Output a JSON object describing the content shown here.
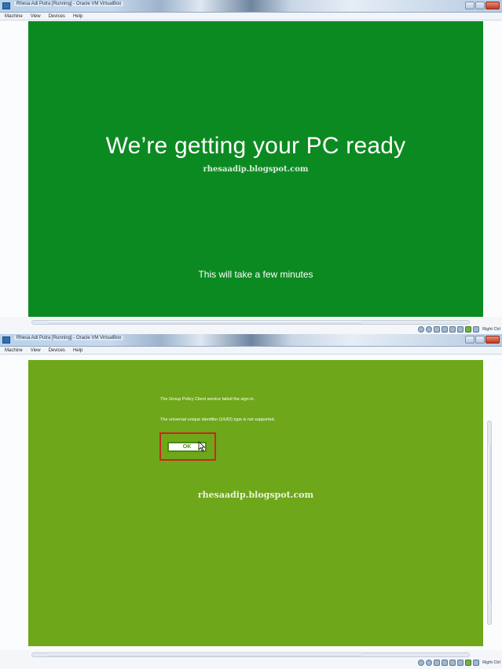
{
  "windows": [
    {
      "title": "Rhesa Adi Putra [Running] - Oracle VM VirtualBox",
      "menu": [
        "Machine",
        "View",
        "Devices",
        "Help"
      ],
      "guest": {
        "heading": "We’re getting your PC ready",
        "watermark": "rhesaadip.blogspot.com",
        "subtitle": "This will take a few minutes",
        "background": "#0c8a22"
      },
      "status": {
        "host_key": "Right Ctrl"
      }
    },
    {
      "title": "Rhesa Adi Putra [Running] - Oracle VM VirtualBox",
      "menu": [
        "Machine",
        "View",
        "Devices",
        "Help"
      ],
      "guest": {
        "error_line_1": "The Group Policy Client service failed the sign-in.",
        "error_line_2": "The universal unique identifier (UUID) type is not supported.",
        "ok_label": "OK",
        "watermark": "rhesaadip.blogspot.com",
        "background": "#6ea71a",
        "highlight_color": "#c8281e"
      },
      "status": {
        "host_key": "Right Ctrl"
      }
    }
  ]
}
